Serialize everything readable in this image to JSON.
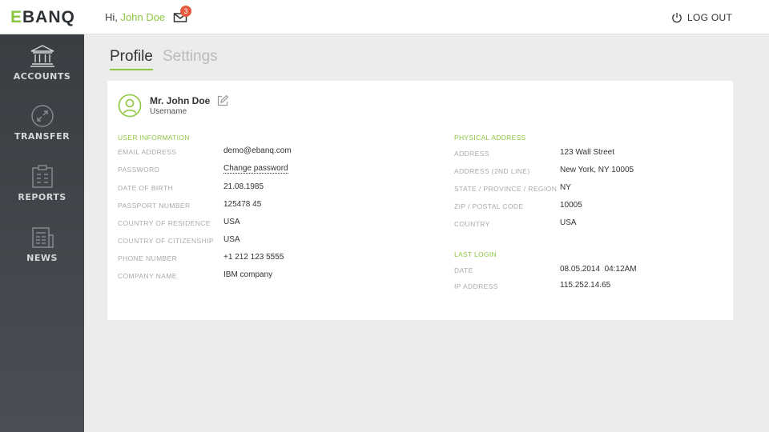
{
  "header": {
    "logo": {
      "first": "E",
      "rest": "BANQ"
    },
    "greeting_prefix": "Hi,",
    "user_name": "John Doe",
    "notification_count": "3",
    "logout_label": "LOG OUT"
  },
  "sidebar": {
    "items": [
      {
        "label": "ACCOUNTS",
        "icon": "bank-icon"
      },
      {
        "label": "TRANSFER",
        "icon": "transfer-icon"
      },
      {
        "label": "REPORTS",
        "icon": "clipboard-icon"
      },
      {
        "label": "NEWS",
        "icon": "newspaper-icon"
      }
    ]
  },
  "tabs": [
    {
      "label": "Profile",
      "active": true
    },
    {
      "label": "Settings",
      "active": false
    }
  ],
  "profile": {
    "full_name": "Mr. John Doe",
    "username_label": "Username",
    "user_info": {
      "title": "USER INFORMATION",
      "rows": [
        {
          "label": "EMAIL ADDRESS",
          "value": "demo@ebanq.com"
        },
        {
          "label": "PASSWORD",
          "value": "Change password"
        },
        {
          "label": "DATE OF BIRTH",
          "value": "21.08.1985"
        },
        {
          "label": "PASSPORT NUMBER",
          "value": "125478 45"
        },
        {
          "label": "COUNTRY OF RESIDENCE",
          "value": "USA"
        },
        {
          "label": "COUNTRY OF CITIZENSHIP",
          "value": "USA"
        },
        {
          "label": "PHONE NUMBER",
          "value": "+1 212 123 5555"
        },
        {
          "label": "COMPANY NAME",
          "value": "IBM company"
        }
      ]
    },
    "physical_address": {
      "title": "PHYSICAL ADDRESS",
      "rows": [
        {
          "label": "ADDRESS",
          "value": "123 Wall Street"
        },
        {
          "label": "ADDRESS (2ND LINE)",
          "value": "New York, NY 10005"
        },
        {
          "label": "STATE / PROVINCE / REGION",
          "value": "NY"
        },
        {
          "label": "ZIP / POSTAL CODE",
          "value": "10005"
        },
        {
          "label": "COUNTRY",
          "value": "USA"
        }
      ]
    },
    "last_login": {
      "title": "LAST LOGIN",
      "rows": [
        {
          "label": "DATE",
          "value": "08.05.2014  04:12AM"
        },
        {
          "label": "IP ADDRESS",
          "value": "115.252.14.65"
        }
      ]
    }
  },
  "colors": {
    "accent": "#8cc63f",
    "badge": "#e55a3c",
    "sidebar": "#3a3d42",
    "background": "#ececec"
  }
}
